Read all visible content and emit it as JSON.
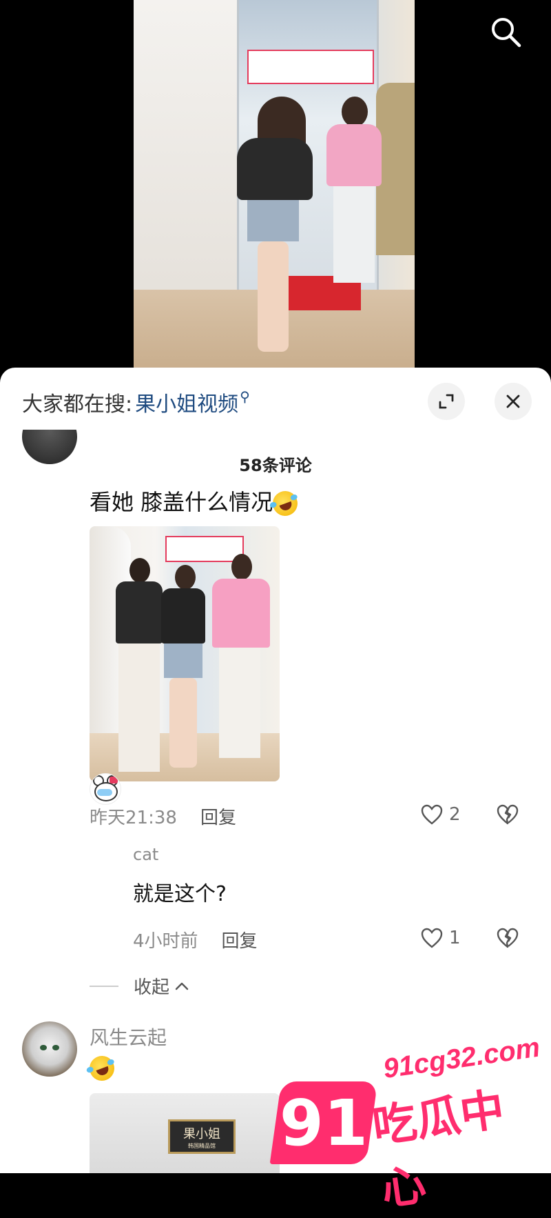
{
  "search": {
    "icon": "search-icon"
  },
  "sheet": {
    "hot_search_label": "大家都在搜:",
    "hot_search_keyword": "果小姐视频",
    "expand_icon": "expand-icon",
    "close_icon": "close-icon",
    "comment_count": "58条评论"
  },
  "comments": [
    {
      "text": "看她 膝盖什么情况",
      "emoji": "rolling-laugh-emoji",
      "time": "昨天21:38",
      "reply_label": "回复",
      "likes": "2",
      "replies": [
        {
          "user": "cat",
          "text": "就是这个?",
          "time": "4小时前",
          "reply_label": "回复",
          "likes": "1"
        }
      ],
      "collapse_label": "收起"
    },
    {
      "user": "风生云起",
      "emoji": "rolling-laugh-emoji",
      "image_sign": "果小姐",
      "image_sign_sub": "韩国精品馆"
    }
  ],
  "watermark": {
    "number": "91",
    "url": "91cg32.com",
    "name": "吃瓜中心"
  },
  "colors": {
    "accent_keyword": "#1f4b80",
    "watermark": "#ff2d6e"
  }
}
